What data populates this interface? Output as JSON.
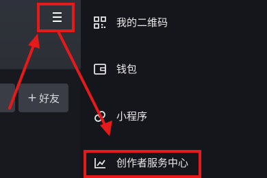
{
  "left": {
    "add_friend_plus": "+",
    "add_friend_label": "好友"
  },
  "drawer": {
    "items": [
      {
        "label": "我的二维码",
        "icon": "qr-code-icon"
      },
      {
        "label": "钱包",
        "icon": "wallet-icon"
      },
      {
        "label": "小程序",
        "icon": "mini-program-icon"
      },
      {
        "label": "创作者服务中心",
        "icon": "chart-line-icon"
      }
    ]
  },
  "colors": {
    "annotation": "#e51a1a",
    "drawer_bg": "#15151c",
    "text": "#eaeaea"
  }
}
